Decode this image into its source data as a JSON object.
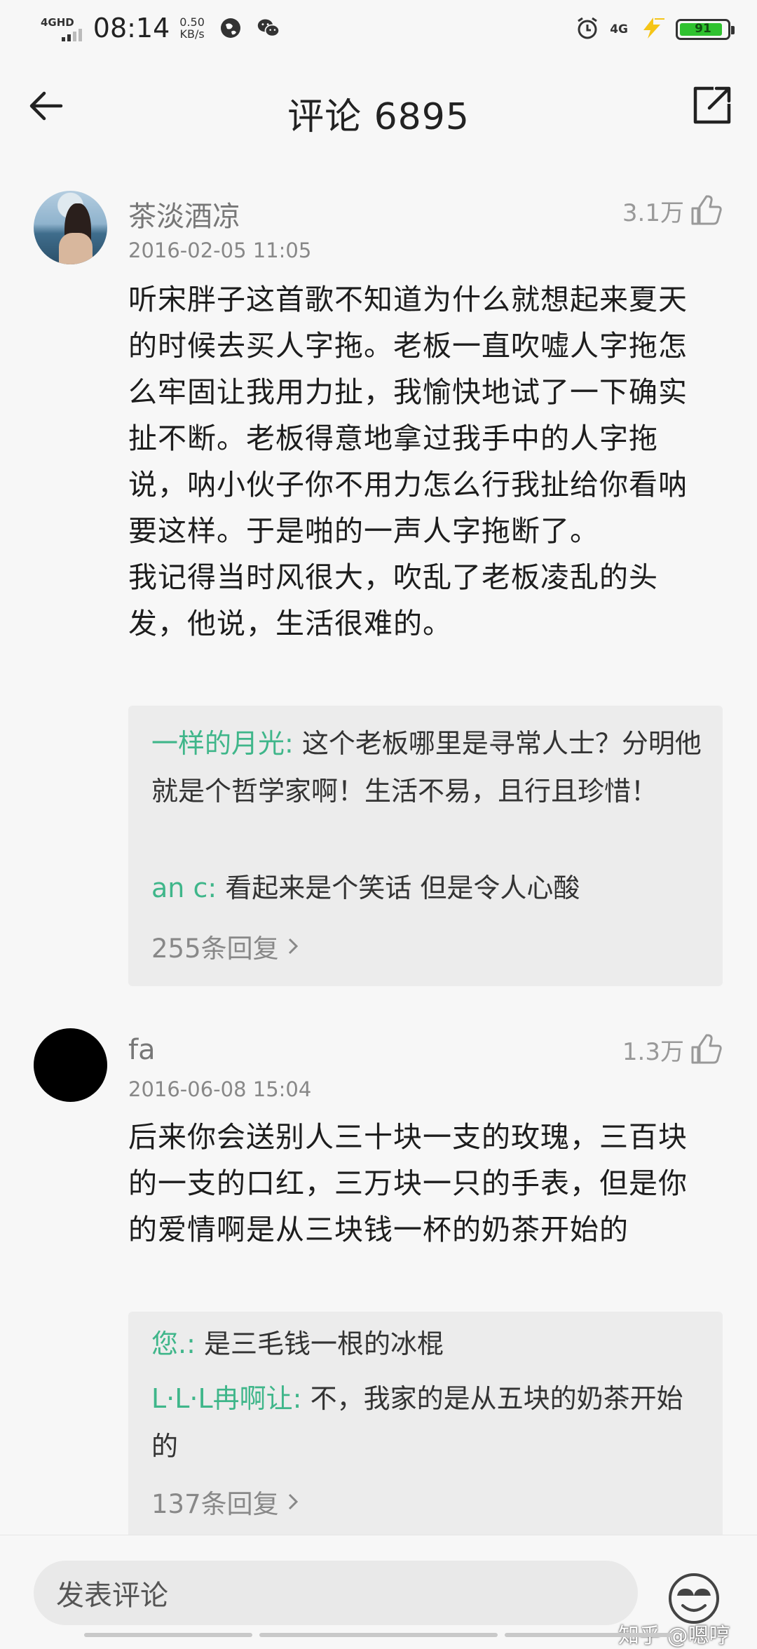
{
  "status_bar": {
    "network_left": "4GHD",
    "time": "08:14",
    "speed_value": "0.50",
    "speed_unit": "KB/s",
    "network_right": "4G",
    "battery": "91",
    "battery_level": 0.91,
    "battery_color": "#2fc22f"
  },
  "header": {
    "title": "评论 6895",
    "back_icon": "arrow-left-icon",
    "share_icon": "share-external-icon"
  },
  "comments": [
    {
      "username": "茶淡酒凉",
      "timestamp": "2016-02-05 11:05",
      "likes": "3.1万",
      "body": "听宋胖子这首歌不知道为什么就想起来夏天的时候去买人字拖。老板一直吹嘘人字拖怎么牢固让我用力扯，我愉快地试了一下确实扯不断。老板得意地拿过我手中的人字拖说，呐小伙子你不用力怎么行我扯给你看呐要这样。于是啪的一声人字拖断了。\n我记得当时风很大，吹乱了老板凌乱的头发，他说，生活很难的。",
      "replies": [
        {
          "name": "一样的月光:",
          "text": " 这个老板哪里是寻常人士？分明他就是个哲学家啊！生活不易，且行且珍惜！"
        },
        {
          "name": "an c:",
          "text": " 看起来是个笑话 但是令人心酸"
        }
      ],
      "more_replies": "255条回复"
    },
    {
      "username": "fa",
      "timestamp": "2016-06-08 15:04",
      "likes": "1.3万",
      "body": "后来你会送别人三十块一支的玫瑰，三百块的一支的口红，三万块一只的手表，但是你的爱情啊是从三块钱一杯的奶茶开始的",
      "replies": [
        {
          "name": "您.:",
          "text": " 是三毛钱一根的冰棍"
        },
        {
          "name": "L·L·L冉啊让:",
          "text": " 不，我家的是从五块的奶茶开始的"
        }
      ],
      "more_replies": "137条回复"
    }
  ],
  "bottom": {
    "input_placeholder": "发表评论",
    "emoji_icon": "emoji-face-icon",
    "watermark": "知乎 @嗯哼"
  },
  "colors": {
    "reply_name": "#3fb68a",
    "background": "#f7f7f7",
    "reply_box": "#ececec"
  }
}
